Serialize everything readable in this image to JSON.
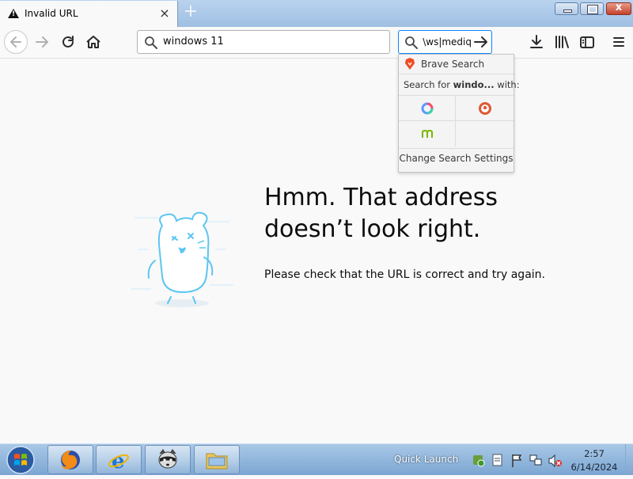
{
  "tab": {
    "title": "Invalid URL",
    "close_icon": "×",
    "new_tab_icon": "+"
  },
  "window_controls": {
    "close": "x"
  },
  "toolbar": {
    "url_value": "windows 11",
    "search_value": "ws|mediq\\"
  },
  "search_popup": {
    "brave_label": "Brave Search",
    "search_for_prefix": "Search for ",
    "search_for_query": "windo...",
    "search_for_suffix": " with:",
    "change_settings": "Change Search Settings",
    "engine_colors": {
      "brave": "#f04c23",
      "duckduckgo": "#de5833",
      "mojeek": "#7ab800"
    }
  },
  "error_page": {
    "title": "Hmm. That address doesn’t look right.",
    "description": "Please check that the URL is correct and try again."
  },
  "taskbar": {
    "quick_launch": "Quick Launch",
    "time": "2:57",
    "date": "6/14/2024"
  },
  "colors": {
    "accent": "#0a84ff",
    "mascot": "#5cc6f2"
  }
}
